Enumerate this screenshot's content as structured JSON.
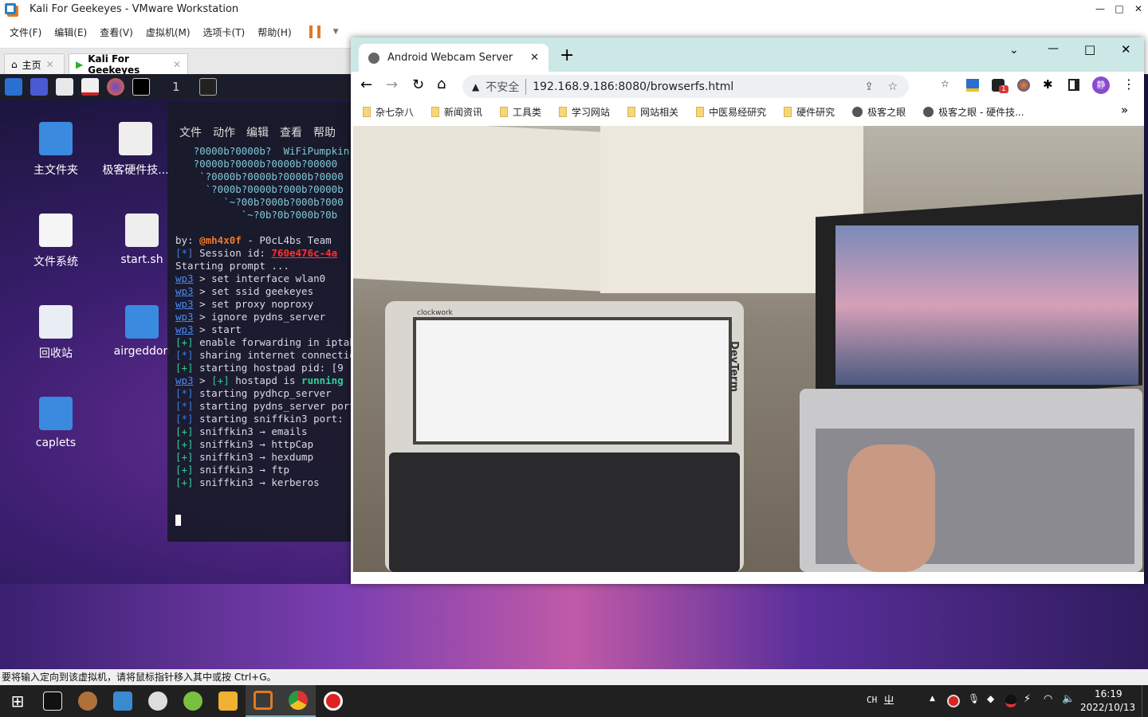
{
  "vmware": {
    "title": "Kali For Geekeyes - VMware Workstation",
    "menu": [
      "文件(F)",
      "编辑(E)",
      "查看(V)",
      "虚拟机(M)",
      "选项卡(T)",
      "帮助(H)"
    ],
    "tabs": [
      {
        "label": "主页"
      },
      {
        "label": "Kali For Geekeyes"
      }
    ],
    "status": "要将输入定向到该虚拟机，请将鼠标指针移入其中或按 Ctrl+G。"
  },
  "kali": {
    "workspace": "1",
    "desktop_icons": [
      {
        "label": "主文件夹",
        "icon": "home-folder-icon"
      },
      {
        "label": "极客硬件技...",
        "icon": "document-icon"
      },
      {
        "label": "文件系统",
        "icon": "drive-icon"
      },
      {
        "label": "start.sh",
        "icon": "script-icon"
      },
      {
        "label": "回收站",
        "icon": "trash-icon"
      },
      {
        "label": "airgeddon",
        "icon": "folder-icon"
      },
      {
        "label": "caplets",
        "icon": "folder-link-icon"
      }
    ],
    "terminal": {
      "menu": [
        "文件",
        "动作",
        "编辑",
        "查看",
        "帮助"
      ],
      "banner": [
        "   ?0000b?0000b?  WiFiPumpkin",
        "   ?0000b?0000b?0000b?00000",
        "    `?0000b?0000b?0000b?0000",
        "     `?000b?0000b?000b?0000b",
        "        `~?00b?000b?000b?000",
        "           `~?0b?0b?000b?0b"
      ],
      "by": "by: ",
      "author": "@mh4x0f",
      "team": " - P0cL4bs Team",
      "session_label": " Session id: ",
      "session_id": "760e476c-4a",
      "starting": "Starting prompt ...",
      "prompt": "wp3",
      "commands": [
        " > set interface wlan0",
        " > set ssid geekeyes",
        " > set proxy noproxy",
        " > ignore pydns_server",
        " > start"
      ],
      "outputs": [
        {
          "tag": "[+]",
          "text": " enable forwarding in iptables"
        },
        {
          "tag": "[*]",
          "text": " sharing internet connection"
        },
        {
          "tag": "[+]",
          "text": " starting hostpad pid: [9"
        }
      ],
      "hostapd_pre": " > ",
      "hostapd_tag": "[+]",
      "hostapd_text": " hostapd is ",
      "hostapd_state": "running",
      "outputs2": [
        {
          "tag": "[*]",
          "text": " starting pydhcp_server"
        },
        {
          "tag": "[*]",
          "text": " starting pydns_server port"
        },
        {
          "tag": "[*]",
          "text": " starting sniffkin3 port:"
        },
        {
          "tag": "[+]",
          "text": " sniffkin3 → emails"
        },
        {
          "tag": "[+]",
          "text": " sniffkin3 → httpCap"
        },
        {
          "tag": "[+]",
          "text": " sniffkin3 → hexdump"
        },
        {
          "tag": "[+]",
          "text": " sniffkin3 → ftp"
        },
        {
          "tag": "[+]",
          "text": " sniffkin3 → kerberos"
        }
      ]
    }
  },
  "chrome": {
    "tab_title": "Android Webcam Server",
    "insecure_label": "不安全",
    "url": "192.168.9.186:8080/browserfs.html",
    "profile_initial": "静",
    "extension_badge": "1",
    "bookmarks": [
      {
        "label": "杂七杂八",
        "icon": "folder-icon"
      },
      {
        "label": "新闻资讯",
        "icon": "folder-icon"
      },
      {
        "label": "工具类",
        "icon": "folder-icon"
      },
      {
        "label": "学习网站",
        "icon": "folder-icon"
      },
      {
        "label": "网站相关",
        "icon": "folder-icon"
      },
      {
        "label": "中医易经研究",
        "icon": "folder-icon"
      },
      {
        "label": "硬件研究",
        "icon": "folder-icon"
      },
      {
        "label": "极客之眼",
        "icon": "globe-icon"
      },
      {
        "label": "极客之眼 - 硬件技...",
        "icon": "globe-icon"
      }
    ],
    "more_bookmarks": "»"
  },
  "photo": {
    "left_device_brand": "clockwork",
    "left_device_name": "DevTerm"
  },
  "taskbar": {
    "ime": "CH",
    "ime2": "ㄓ",
    "time": "16:19",
    "date": "2022/10/13"
  },
  "colors": {
    "chrome_tabbar": "#cce8e6",
    "kali_panel": "#1b1d2a",
    "taskbar": "#202020",
    "accent_orange": "#e07a20"
  }
}
